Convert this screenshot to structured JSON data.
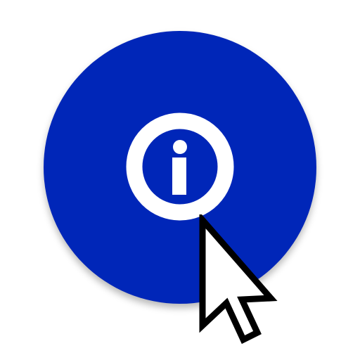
{
  "button": {
    "name": "info-button",
    "color": "#0026B8",
    "icon": "info-icon",
    "icon_color": "#FFFFFF"
  },
  "pointer": {
    "icon": "cursor-arrow-icon",
    "fill": "#FFFFFF",
    "stroke": "#000000"
  }
}
